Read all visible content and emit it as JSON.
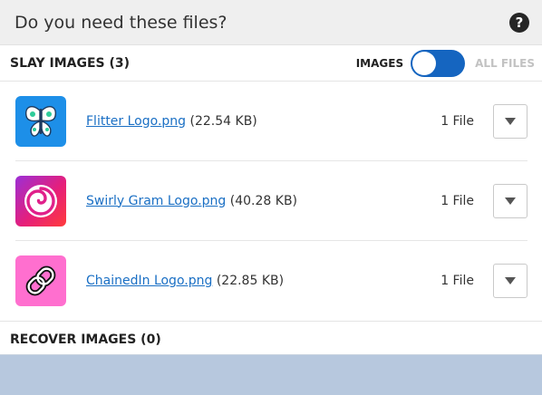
{
  "header": {
    "title": "Do you need these files?",
    "help_icon": "question-circle-icon"
  },
  "slay_section": {
    "title": "SLAY IMAGES (3)",
    "toggle": {
      "left_label": "IMAGES",
      "right_label": "ALL FILES",
      "state": "images"
    }
  },
  "files": [
    {
      "name": "Flitter Logo.png",
      "size": "(22.54 KB)",
      "count": "1 File",
      "icon": "butterfly-icon",
      "thumb_color": "#1d8fe8"
    },
    {
      "name": "Swirly Gram Logo.png",
      "size": "(40.28 KB)",
      "count": "1 File",
      "icon": "swirl-icon",
      "thumb_color": "#d81b7a"
    },
    {
      "name": "ChainedIn Logo.png",
      "size": "(22.85 KB)",
      "count": "1 File",
      "icon": "chain-link-icon",
      "thumb_color": "#ff6fcf"
    }
  ],
  "recover_section": {
    "title": "RECOVER IMAGES (0)"
  },
  "colors": {
    "accent": "#1565c0",
    "link": "#1a6fc4",
    "backdrop": "#b7c8de"
  }
}
